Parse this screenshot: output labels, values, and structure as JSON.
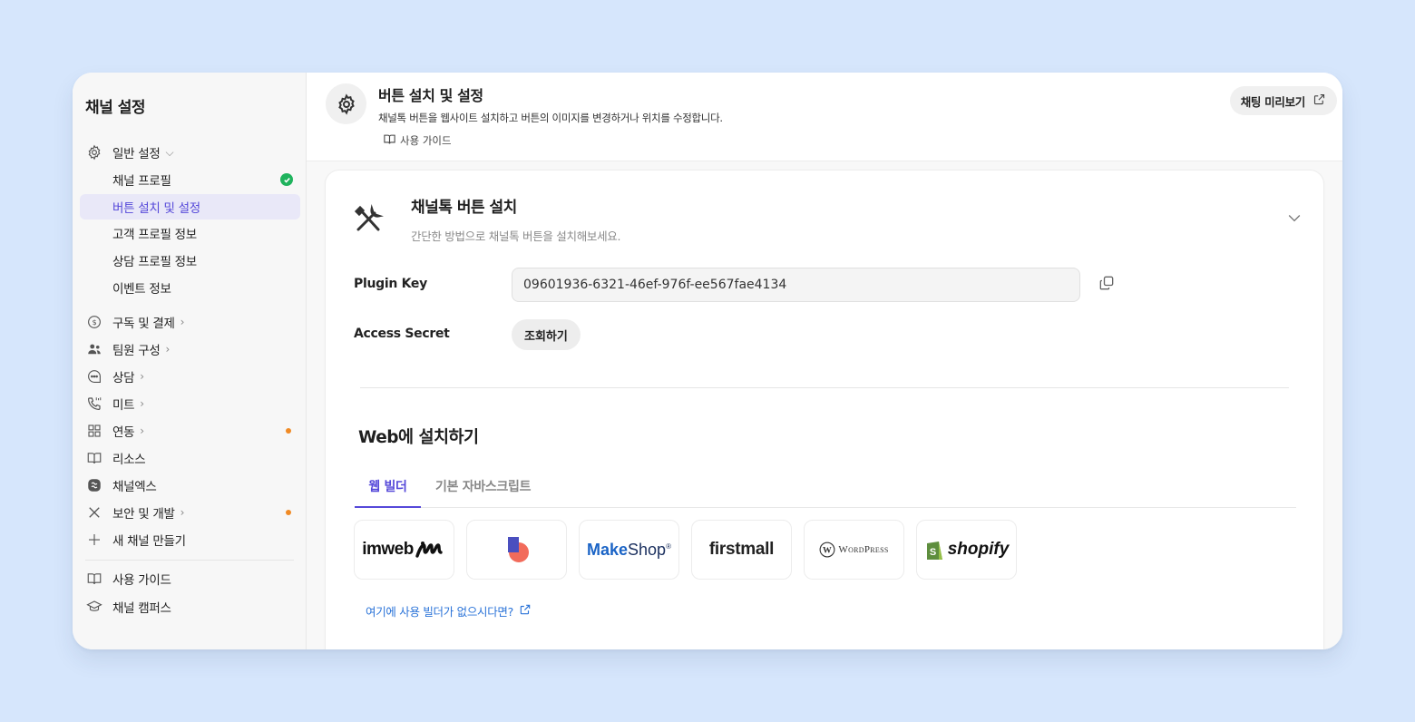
{
  "sidebar": {
    "title": "채널 설정",
    "general": {
      "label": "일반 설정",
      "chevron": "⌵"
    },
    "sub_items": [
      {
        "label": "채널 프로필",
        "status": "check"
      },
      {
        "label": "버튼 설치 및 설정",
        "active": true
      },
      {
        "label": "고객 프로필 정보"
      },
      {
        "label": "상담 프로필 정보"
      },
      {
        "label": "이벤트 정보"
      }
    ],
    "items": [
      {
        "label": "구독 및 결제",
        "chevron": "›",
        "icon": "dollar-circle-icon"
      },
      {
        "label": "팀원 구성",
        "chevron": "›",
        "icon": "people-icon"
      },
      {
        "label": "상담",
        "chevron": "›",
        "icon": "chat-bubble-icon"
      },
      {
        "label": "미트",
        "chevron": "›",
        "icon": "phone-icon"
      },
      {
        "label": "연동",
        "chevron": "›",
        "icon": "grid-icon",
        "dot": true
      },
      {
        "label": "리소스",
        "icon": "book-icon"
      },
      {
        "label": "채널엑스",
        "icon": "channelx-icon"
      },
      {
        "label": "보안 및 개발",
        "chevron": "›",
        "icon": "tools-icon",
        "dot": true
      },
      {
        "label": "새 채널 만들기",
        "icon": "plus-icon"
      }
    ],
    "bottom_items": [
      {
        "label": "사용 가이드",
        "icon": "book-icon"
      },
      {
        "label": "채널 캠퍼스",
        "icon": "graduation-cap-icon"
      }
    ]
  },
  "header": {
    "title": "버튼 설치 및 설정",
    "description": "채널톡 버튼을 웹사이트 설치하고 버튼의 이미지를 변경하거나 위치를 수정합니다.",
    "guide_label": "사용 가이드",
    "preview_label": "채팅 미리보기"
  },
  "card": {
    "title": "채널톡 버튼 설치",
    "subtitle": "간단한 방법으로 채널톡 버튼을 설치해보세요.",
    "plugin_key_label": "Plugin Key",
    "plugin_key_value": "09601936-6321-46ef-976f-ee567fae4134",
    "access_secret_label": "Access Secret",
    "view_button_label": "조회하기",
    "web_section_title": "Web에 설치하기",
    "tabs": [
      {
        "label": "웹 빌더",
        "active": true
      },
      {
        "label": "기본 자바스크립트",
        "active": false
      }
    ],
    "builders": [
      {
        "name": "imweb",
        "text": "imweb"
      },
      {
        "name": "cafe24-style",
        "text": ""
      },
      {
        "name": "makeshop",
        "text_bold": "Make",
        "text_rest": "Shop"
      },
      {
        "name": "firstmall",
        "text": "firstmall"
      },
      {
        "name": "wordpress",
        "text": "WordPress"
      },
      {
        "name": "shopify",
        "text": "shopify"
      }
    ],
    "builder_link": "여기에 사용 빌더가 없으시다면?"
  },
  "colors": {
    "accent": "#5548d9",
    "link": "#2a73d8",
    "green": "#1fb35d",
    "orange_dot": "#f08a24",
    "background": "#d6e6fc"
  }
}
